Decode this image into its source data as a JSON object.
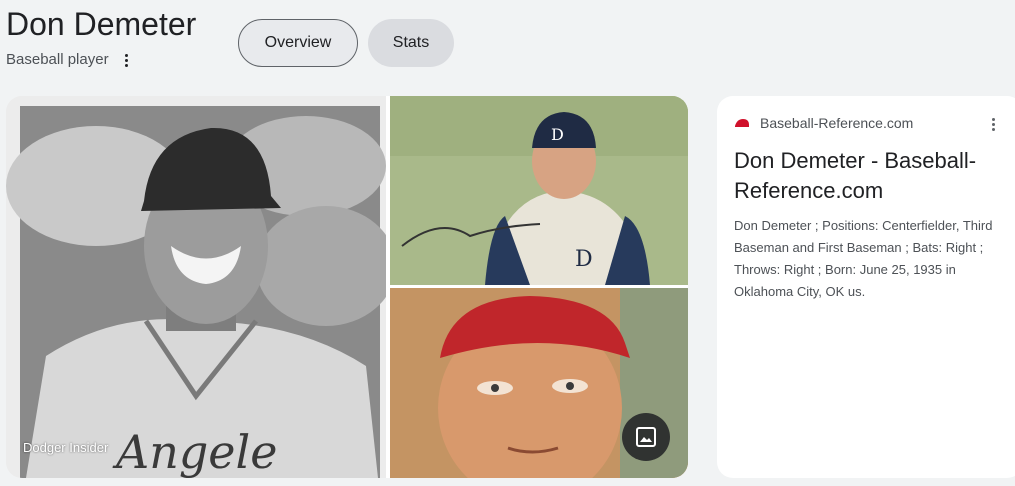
{
  "entity": {
    "name": "Don Demeter",
    "description": "Baseball player"
  },
  "tabs": [
    {
      "label": "Overview",
      "selected": true
    },
    {
      "label": "Stats",
      "selected": false
    }
  ],
  "gallery": {
    "credit": "Dodger Insider",
    "images_icon": "image-icon"
  },
  "result": {
    "source": "Baseball-Reference.com",
    "title": "Don Demeter - Baseball-Reference.com",
    "snippet": "Don Demeter ; Positions: Centerfielder, Third Baseman and First Baseman ; Bats: Right ; Throws: Right ; Born: June 25, 1935 in Oklahoma City, OK us."
  },
  "colors": {
    "page_bg": "#f1f3f4",
    "favicon": "#d0112b"
  }
}
